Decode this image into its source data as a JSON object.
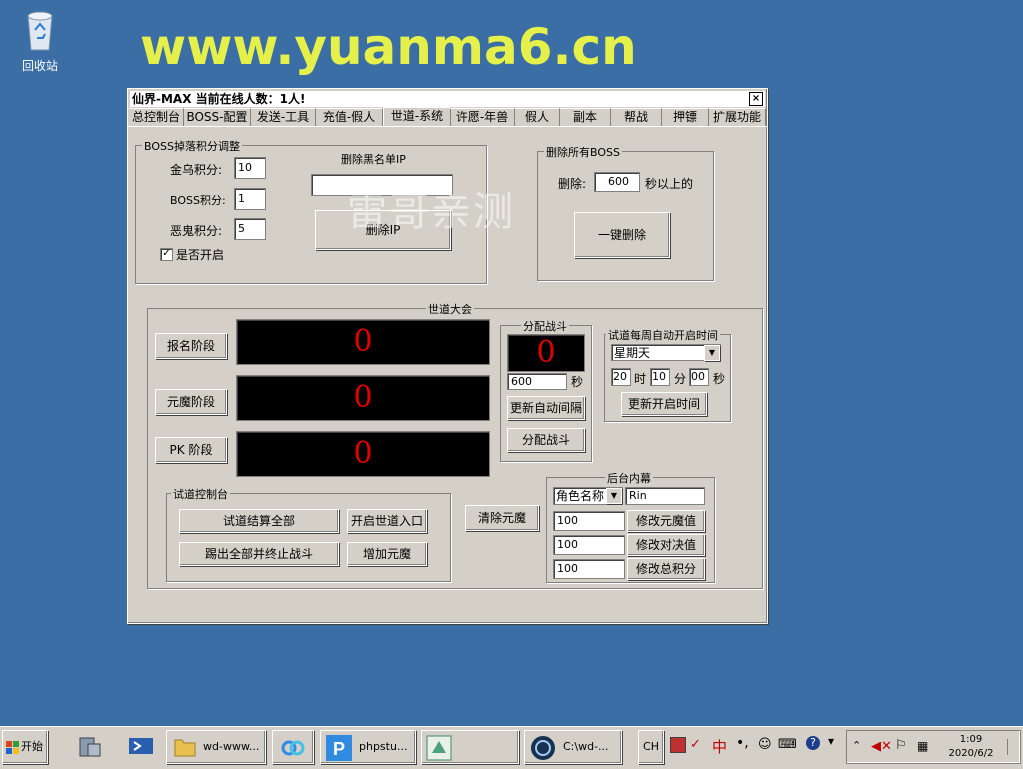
{
  "desktop": {
    "recycle_bin_label": "回收站",
    "watermark_url": "www.yuanma6.cn"
  },
  "window": {
    "title": "仙界-MAX  当前在线人数：1人!",
    "close_label": "×",
    "overlay_text": "雷哥亲测",
    "tabs": [
      "总控制台",
      "BOSS-配置",
      "发送-工具",
      "充值-假人",
      "世道-系统",
      "许愿-年兽",
      "假人",
      "副本",
      "帮战",
      "押镖",
      "扩展功能"
    ],
    "active_tab": "世道-系统"
  },
  "boss_points": {
    "title": "BOSS掉落积分调整",
    "golden_bird_label": "金乌积分:",
    "golden_bird_value": "10",
    "boss_label": "BOSS积分:",
    "boss_value": "1",
    "evil_ghost_label": "恶鬼积分:",
    "evil_ghost_value": "5",
    "enable_label": "是否开启",
    "enable_checked": true,
    "blacklist_label": "删除黑名单IP",
    "blacklist_value": "",
    "delete_ip_button": "删除IP"
  },
  "delete_boss": {
    "title": "删除所有BOSS",
    "delete_label": "删除:",
    "seconds_value": "600",
    "seconds_suffix": "秒以上的",
    "one_click_button": "一键删除"
  },
  "world_conference": {
    "title": "世道大会",
    "signup_button": "报名阶段",
    "signup_count": "0",
    "demon_button": "元魔阶段",
    "demon_count": "0",
    "pk_button": "PK 阶段",
    "pk_count": "0",
    "assign_battle": {
      "title": "分配战斗",
      "count": "0",
      "interval_value": "600",
      "interval_suffix": "秒",
      "update_interval_button": "更新自动间隔",
      "assign_button": "分配战斗"
    },
    "weekly": {
      "title": "试道每周自动开启时间",
      "weekday": "星期天",
      "hour": "20",
      "hour_label": "时",
      "minute": "10",
      "minute_label": "分",
      "second": "00",
      "second_label": "秒",
      "update_button": "更新开启时间"
    },
    "console": {
      "title": "试道控制台",
      "settle_all_button": "试道结算全部",
      "open_entrance_button": "开启世道入口",
      "kick_all_button": "踢出全部并终止战斗",
      "add_demon_button": "增加元魔"
    },
    "clear_demon_button": "清除元魔",
    "backstage": {
      "title": "后台内幕",
      "name_select": "角色名称",
      "name_value": "Rin",
      "demon_value": "100",
      "demon_button": "修改元魔值",
      "duel_value": "100",
      "duel_button": "修改对决值",
      "total_value": "100",
      "total_button": "修改总积分"
    }
  },
  "taskbar": {
    "start_label": "开始",
    "items": [
      "wd-www...",
      "phpstu...",
      "C:\\wd-..."
    ],
    "lang": "CH",
    "ime_label": "中",
    "time": "1:09",
    "date": "2020/6/2"
  },
  "colors": {
    "desktop": "#3a6ea5",
    "watermark": "#e6f04a",
    "led_digit": "#e00000"
  }
}
